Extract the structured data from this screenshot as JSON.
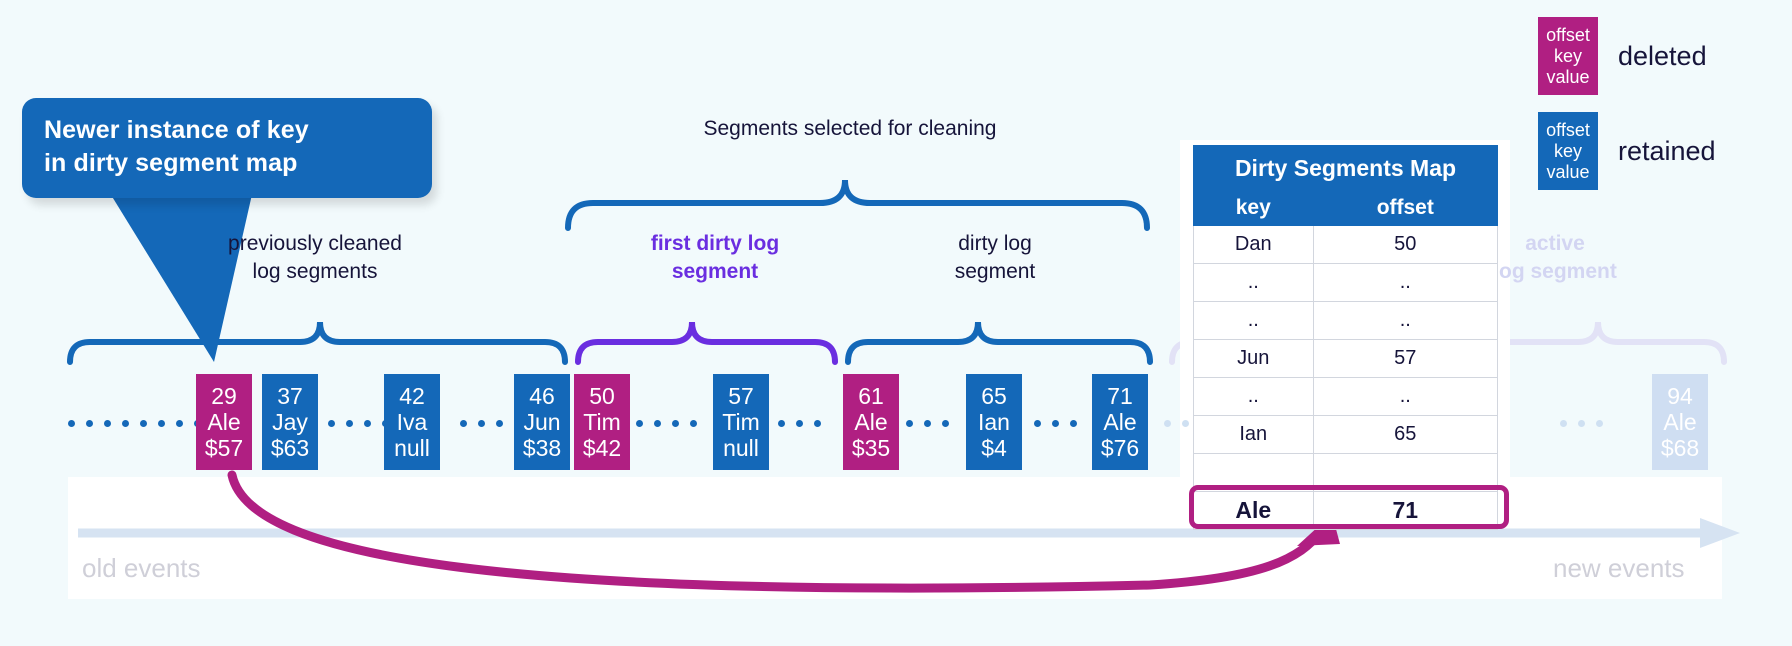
{
  "callout": {
    "line1": "Newer instance of key",
    "line2": "in dirty segment map"
  },
  "labels": {
    "segments_selected": "Segments selected for cleaning",
    "previously_cleaned_l1": "previously cleaned",
    "previously_cleaned_l2": "log segments",
    "first_dirty_l1": "first dirty log",
    "first_dirty_l2": "segment",
    "dirty_l1": "dirty log",
    "dirty_l2": "segment",
    "active_l1": "active",
    "active_l2": "log segment"
  },
  "axis": {
    "old": "old events",
    "new": "new events"
  },
  "segments": [
    {
      "offset": "29",
      "key": "Ale",
      "value": "$57",
      "state": "del"
    },
    {
      "offset": "37",
      "key": "Jay",
      "value": "$63",
      "state": "ret"
    },
    {
      "offset": "42",
      "key": "Iva",
      "value": "null",
      "state": "ret"
    },
    {
      "offset": "46",
      "key": "Jun",
      "value": "$38",
      "state": "ret"
    },
    {
      "offset": "50",
      "key": "Tim",
      "value": "$42",
      "state": "del"
    },
    {
      "offset": "57",
      "key": "Tim",
      "value": "null",
      "state": "ret"
    },
    {
      "offset": "61",
      "key": "Ale",
      "value": "$35",
      "state": "del"
    },
    {
      "offset": "65",
      "key": "Ian",
      "value": "$4",
      "state": "ret"
    },
    {
      "offset": "71",
      "key": "Ale",
      "value": "$76",
      "state": "ret"
    },
    {
      "offset": "94",
      "key": "Ale",
      "value": "$68",
      "state": "ghost"
    }
  ],
  "table": {
    "title": "Dirty Segments Map",
    "columns": [
      "key",
      "offset"
    ],
    "rows": [
      {
        "key": "Dan",
        "offset": "50",
        "highlight": false
      },
      {
        "key": "..",
        "offset": "..",
        "highlight": false
      },
      {
        "key": "..",
        "offset": "..",
        "highlight": false
      },
      {
        "key": "Jun",
        "offset": "57",
        "highlight": false
      },
      {
        "key": "..",
        "offset": "..",
        "highlight": false
      },
      {
        "key": "Ian",
        "offset": "65",
        "highlight": false
      },
      {
        "key": "",
        "offset": "",
        "highlight": false
      },
      {
        "key": "Ale",
        "offset": "71",
        "highlight": true
      }
    ]
  },
  "legend": [
    {
      "swatch_l1": "offset",
      "swatch_l2": "key",
      "swatch_l3": "value",
      "label": "deleted",
      "state": "del"
    },
    {
      "swatch_l1": "offset",
      "swatch_l2": "key",
      "swatch_l3": "value",
      "label": "retained",
      "state": "ret"
    }
  ],
  "colors": {
    "deleted": "#B01F82",
    "retained": "#1468B8",
    "first_dirty": "#6A2EE0",
    "background": "#F2FAFC",
    "faded": "#D3D5F2",
    "axis": "#D6E3F2"
  }
}
